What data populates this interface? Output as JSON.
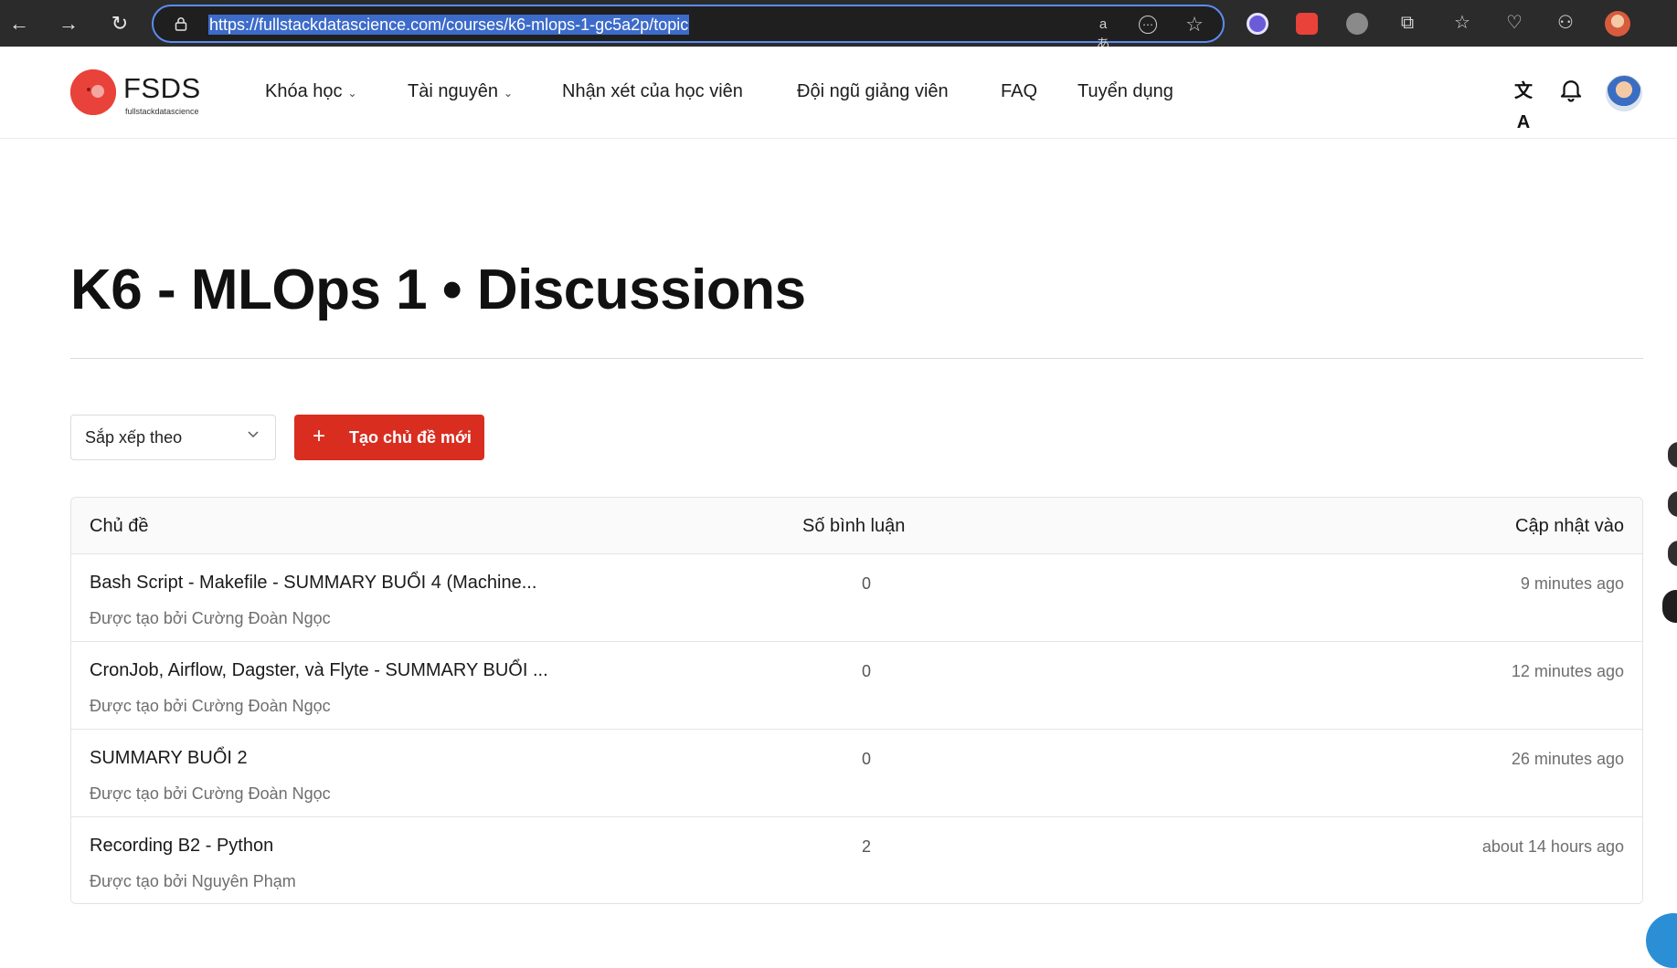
{
  "browser": {
    "url": "https://fullstackdatascience.com/courses/k6-mlops-1-gc5a2p/topic",
    "back_icon": "←",
    "forward_icon": "→",
    "reload_icon": "↻",
    "read_aloud_icon": "aあ",
    "more_icon": "⋯",
    "favorite_icon": "☆",
    "extensions_icon": "⧉",
    "collections_icon": "☆",
    "health_icon": "♡",
    "share_icon": "⚇"
  },
  "site": {
    "logo_text": "FSDS",
    "logo_sub": "fullstackdatascience",
    "menu": [
      {
        "label": "Khóa học",
        "has_caret": true
      },
      {
        "label": "Tài nguyên",
        "has_caret": true
      },
      {
        "label": "Nhận xét của học viên",
        "has_caret": false
      },
      {
        "label": "Đội ngũ giảng viên",
        "has_caret": false
      },
      {
        "label": "FAQ",
        "has_caret": false
      },
      {
        "label": "Tuyển dụng",
        "has_caret": false
      }
    ],
    "caret_symbol": "⌄",
    "translate_icon": "文A",
    "bell_icon": "🔔"
  },
  "page": {
    "title": "K6 - MLOps 1 • Discussions",
    "sort_label": "Sắp xếp theo",
    "sort_chevron": "⌄",
    "new_topic_plus": "+",
    "new_topic_label": "Tạo chủ đề mới"
  },
  "table": {
    "headers": {
      "topic": "Chủ đề",
      "comments": "Số bình luận",
      "updated": "Cập nhật vào"
    },
    "rows": [
      {
        "title": "Bash Script - Makefile - SUMMARY BUỔI 4 (Machine...",
        "author": "Được tạo bởi Cường Đoàn Ngọc",
        "comments": "0",
        "updated": "9 minutes ago"
      },
      {
        "title": "CronJob, Airflow, Dagster, và Flyte - SUMMARY BUỔI ...",
        "author": "Được tạo bởi Cường Đoàn Ngọc",
        "comments": "0",
        "updated": "12 minutes ago"
      },
      {
        "title": "SUMMARY BUỔI 2",
        "author": "Được tạo bởi Cường Đoàn Ngọc",
        "comments": "0",
        "updated": "26 minutes ago"
      },
      {
        "title": "Recording B2 - Python",
        "author": "Được tạo bởi Nguyên Phạm",
        "comments": "2",
        "updated": "about 14 hours ago"
      }
    ]
  },
  "colors": {
    "brand_red": "#d92d20",
    "chrome_bg": "#2b2b2b",
    "url_highlight": "#3d6bc9",
    "address_border": "#5b8def"
  }
}
